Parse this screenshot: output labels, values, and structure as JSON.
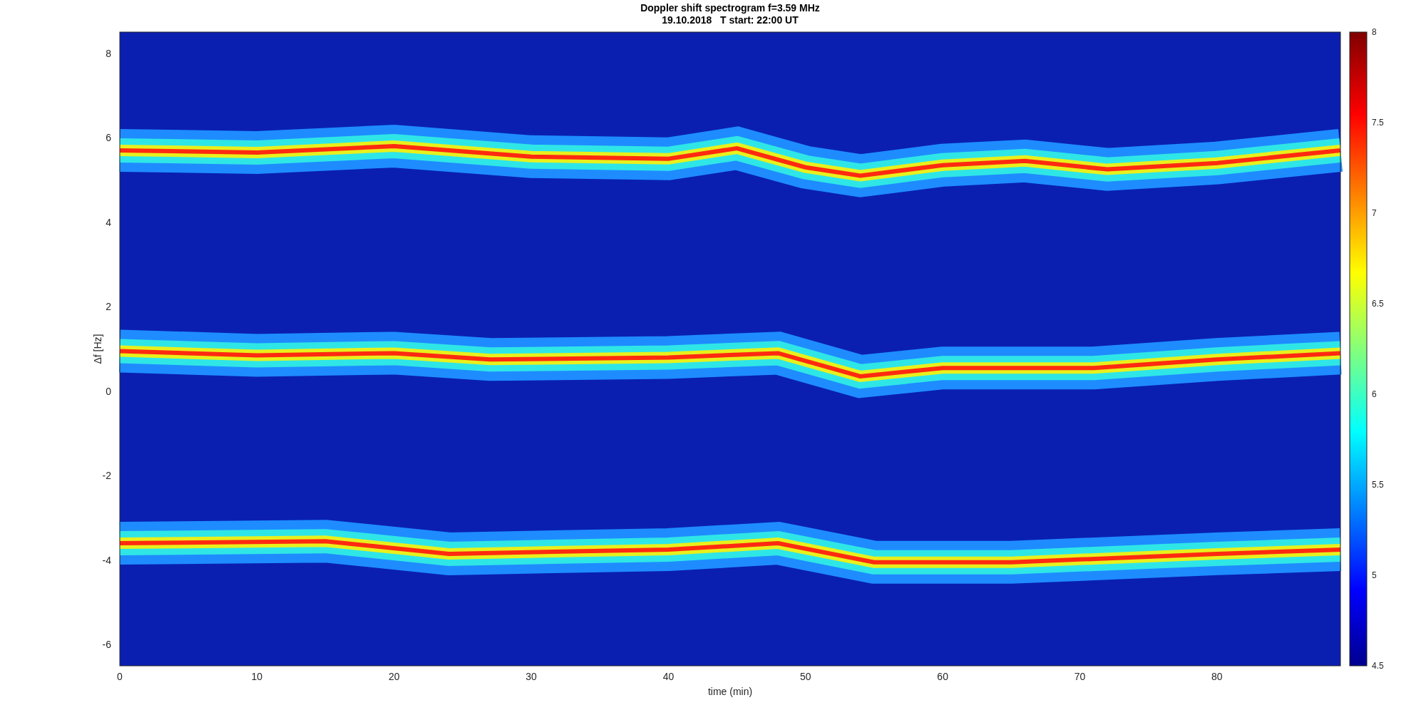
{
  "chart": {
    "title_lines": [
      "Doppler shift spectrogram f=3.59 MHz",
      "19.10.2018   T start: 22:00 UT"
    ],
    "xlabel": "time (min)",
    "ylabel": "Δf [Hz]",
    "xticks": [
      "0",
      "10",
      "20",
      "30",
      "40",
      "50",
      "60",
      "70",
      "80"
    ],
    "yticks": [
      "8",
      "6",
      "4",
      "2",
      "0",
      "-2",
      "-4",
      "-6"
    ],
    "colorbar_ticks": [
      "8",
      "7.5",
      "7",
      "6.5",
      "6",
      "5.5",
      "5",
      "4.5"
    ]
  }
}
